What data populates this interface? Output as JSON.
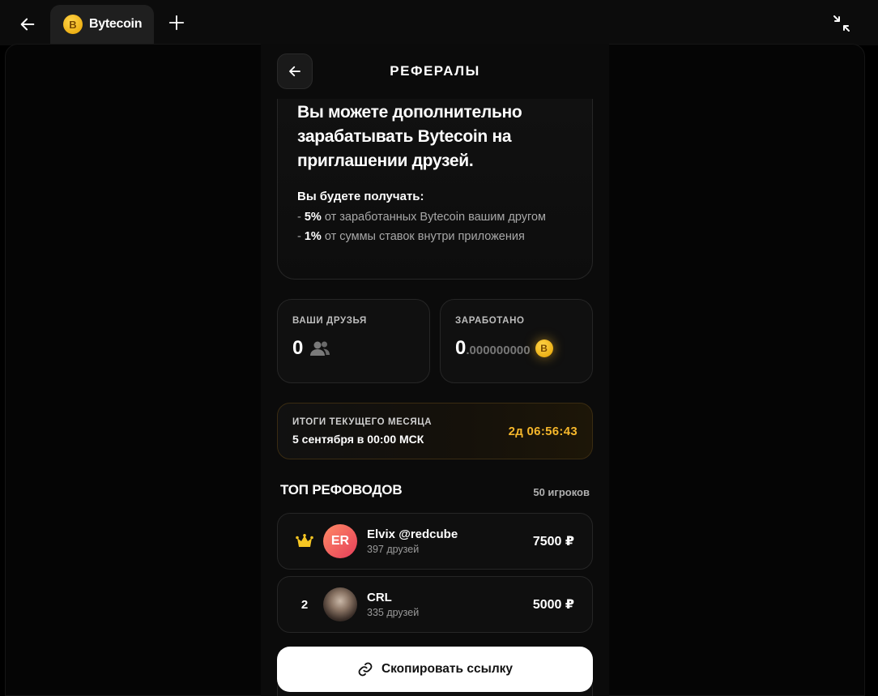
{
  "browser": {
    "tab_title": "Bytecoin",
    "coin_symbol": "B"
  },
  "header": {
    "title": "РЕФЕРАЛЫ"
  },
  "info": {
    "headline": "Вы можете дополнительно зарабатывать Bytecoin на приглашении друзей.",
    "subtitle": "Вы будете получать:",
    "perks": [
      {
        "prefix": "- ",
        "value": "5%",
        "text": " от заработанных Bytecoin вашим другом"
      },
      {
        "prefix": "- ",
        "value": "1%",
        "text": " от суммы ставок внутри приложения"
      }
    ]
  },
  "stats": {
    "friends": {
      "label": "ВАШИ ДРУЗЬЯ",
      "value": "0"
    },
    "earned": {
      "label": "ЗАРАБОТАНО",
      "value_int": "0",
      "value_dec": ".000000000",
      "coin_symbol": "B"
    }
  },
  "monthly": {
    "label": "ИТОГИ ТЕКУЩЕГО МЕСЯЦА",
    "date": "5 сентября в 00:00 МСК",
    "timer": "2д 06:56:43"
  },
  "top": {
    "title": "ТОП РЕФОВОДОВ",
    "count": "50 игроков",
    "rows": [
      {
        "rank": "1",
        "initials": "ER",
        "name": "Elvix @redcube",
        "friends": "397 друзей",
        "amount": "7500 ₽"
      },
      {
        "rank": "2",
        "initials": "",
        "name": "CRL",
        "friends": "335 друзей",
        "amount": "5000 ₽"
      }
    ]
  },
  "copy_button": {
    "label": "Скопировать ссылку"
  },
  "colors": {
    "accent_gold": "#f6b72b",
    "background": "#0b0b0b",
    "button_bg": "#ffffff"
  }
}
